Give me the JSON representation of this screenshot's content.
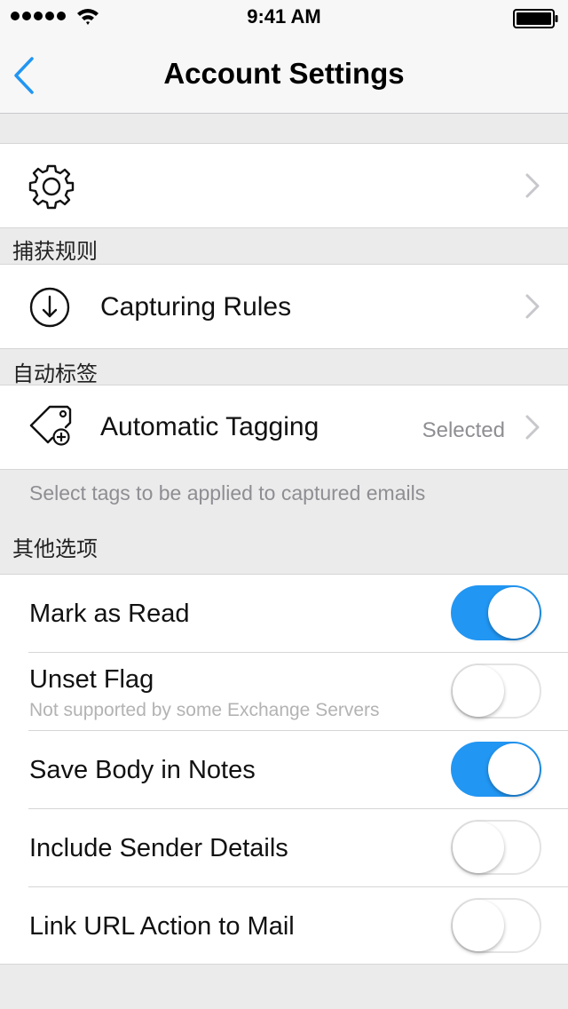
{
  "status_bar": {
    "time": "9:41 AM"
  },
  "nav": {
    "title": "Account Settings"
  },
  "gear_row": {
    "icon": "gear-icon"
  },
  "capturing": {
    "header": "捕获规则",
    "label": "Capturing Rules",
    "icon": "download-circle-icon"
  },
  "tagging": {
    "header": "自动标签",
    "label": "Automatic Tagging",
    "detail": "Selected",
    "icon": "tag-plus-icon",
    "footer": "Select tags to be applied to captured emails"
  },
  "options": {
    "header": "其他选项",
    "items": [
      {
        "label": "Mark as Read",
        "sublabel": "",
        "on": true
      },
      {
        "label": "Unset Flag",
        "sublabel": "Not supported by some Exchange Servers",
        "on": false
      },
      {
        "label": "Save Body in Notes",
        "sublabel": "",
        "on": true
      },
      {
        "label": "Include Sender Details",
        "sublabel": "",
        "on": false
      },
      {
        "label": "Link URL Action to Mail",
        "sublabel": "",
        "on": false
      }
    ]
  },
  "colors": {
    "accent": "#2196f3",
    "toggle_on": "#2196f3",
    "background": "#ebebeb"
  }
}
